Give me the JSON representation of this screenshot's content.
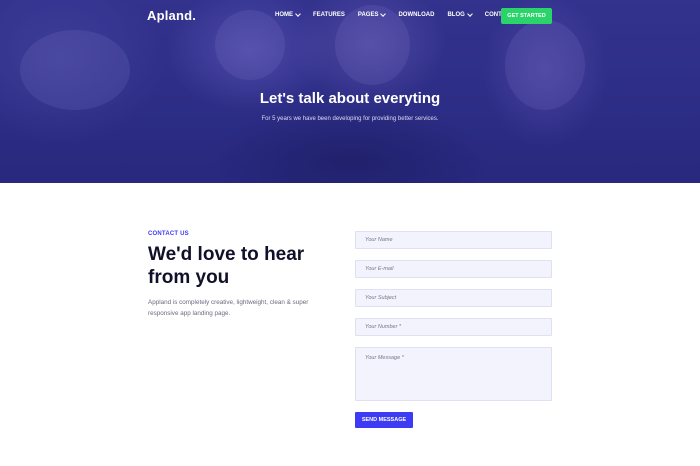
{
  "brand": {
    "logo": "Apland."
  },
  "nav": {
    "items": [
      {
        "label": "HOME",
        "dropdown": true
      },
      {
        "label": "FEATURES",
        "dropdown": false
      },
      {
        "label": "PAGES",
        "dropdown": true
      },
      {
        "label": "DOWNLOAD",
        "dropdown": false
      },
      {
        "label": "BLOG",
        "dropdown": true
      },
      {
        "label": "CONTACT",
        "dropdown": false
      }
    ],
    "cta_label": "GET STARTED"
  },
  "hero": {
    "title": "Let's talk about everyting",
    "subtitle": "For 5 years we have been developing for providing better services."
  },
  "contact": {
    "eyebrow": "CONTACT US",
    "heading": "We'd love to hear from you",
    "description": "Appland is completely creative, lightweight, clean & super responsive app landing page."
  },
  "form": {
    "name_placeholder": "Your Name",
    "email_placeholder": "Your E-mail",
    "subject_placeholder": "Your Subject",
    "number_placeholder": "Your Number *",
    "message_placeholder": "Your Message *",
    "submit_label": "SEND MESSAGE"
  },
  "colors": {
    "accent": "#3d3bf3",
    "cta_green": "#2bd36b",
    "hero_overlay": "#2c2d85",
    "input_bg": "#f2f3fd"
  }
}
